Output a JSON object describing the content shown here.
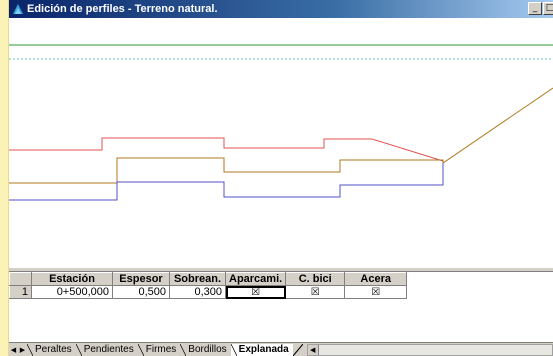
{
  "window": {
    "title": "Edición de perfiles - Terreno natural.",
    "minimize_glyph": "_",
    "maximize_glyph": "□"
  },
  "grid": {
    "headers": [
      "Estación",
      "Espesor",
      "Sobrean.",
      "Aparcami.",
      "C. bici",
      "Acera"
    ],
    "rows": [
      {
        "num": "1",
        "estacion": "0+500,000",
        "espesor": "0,500",
        "sobrean": "0,300",
        "aparcami": "☒",
        "cbici": "☒",
        "acera": "☒"
      }
    ]
  },
  "tabs": {
    "nav_first": "◀",
    "nav_next": "▶",
    "items": [
      "Peraltes",
      "Pendientes",
      "Firmes",
      "Bordillos",
      "Explanada"
    ],
    "active": "Explanada",
    "scroll_left": "◀"
  },
  "colors": {
    "green_line": "#2e9a3a",
    "dashed_line": "#6ac0d0",
    "red_line": "#e05050",
    "brown_line": "#b07820",
    "blue_line": "#5050c8"
  }
}
